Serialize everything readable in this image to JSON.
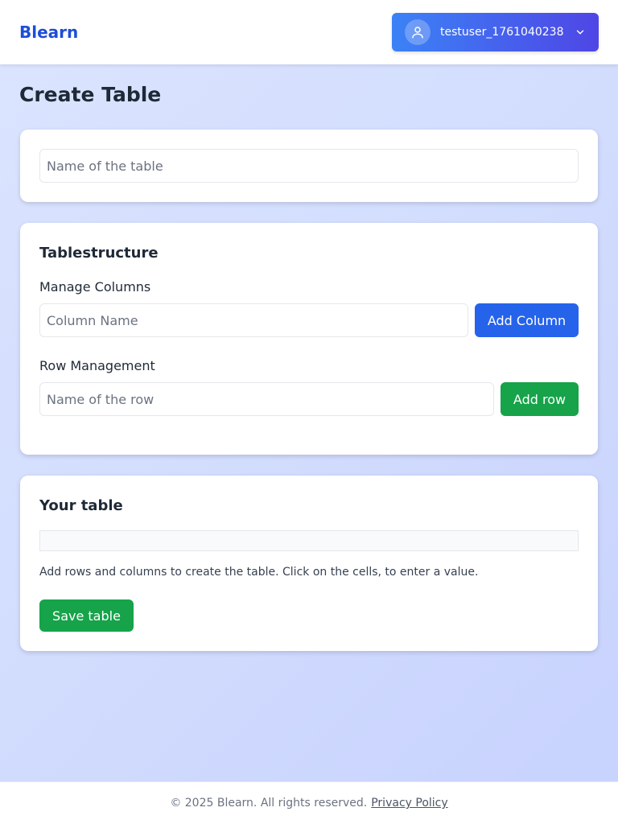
{
  "header": {
    "brand": "Blearn",
    "user": {
      "username": "testuser_1761040238",
      "avatar_icon": "user-icon",
      "dropdown_icon": "chevron-down-icon"
    }
  },
  "page": {
    "title": "Create Table"
  },
  "table_name": {
    "placeholder": "Name of the table",
    "value": ""
  },
  "structure": {
    "title": "Tablestructure",
    "columns": {
      "label": "Manage Columns",
      "placeholder": "Column Name",
      "button": "Add Column"
    },
    "rows": {
      "label": "Row Management",
      "placeholder": "Name of the row",
      "button": "Add row"
    }
  },
  "your_table": {
    "title": "Your table",
    "hint": "Add rows and columns to create the table. Click on the cells, to enter a value.",
    "save_button": "Save table"
  },
  "footer": {
    "copyright": "© 2025 Blearn. All rights reserved.",
    "privacy_link": "Privacy Policy"
  },
  "colors": {
    "brand": "#1d4ed8",
    "primary_button": "#2563eb",
    "success_button": "#16a34a",
    "user_button_gradient": [
      "#3b82f6",
      "#4f46e5"
    ]
  }
}
